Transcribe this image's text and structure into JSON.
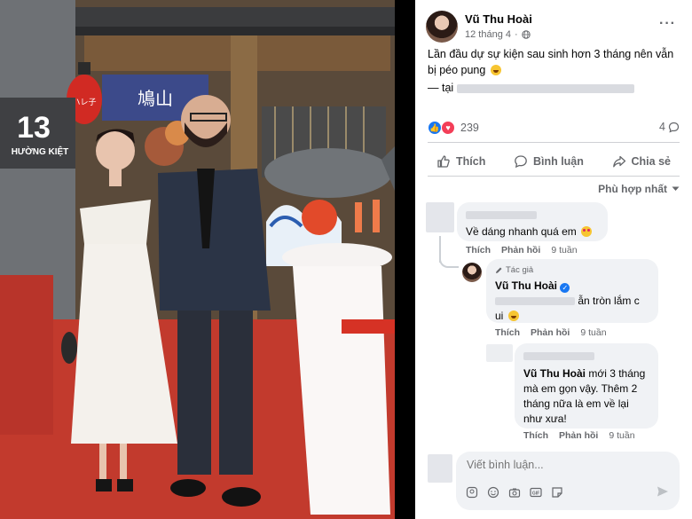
{
  "post": {
    "author": "Vũ Thu Hoài",
    "date": "12 tháng 4",
    "text": "Lần đầu dự sự kiện sau sinh hơn 3 tháng nên vẫn bị péo pung",
    "location_prefix": "— tại",
    "reaction_count": "239",
    "comment_count": "4"
  },
  "actions": {
    "like": "Thích",
    "comment": "Bình luận",
    "share": "Chia sẻ"
  },
  "sort_label": "Phù hợp nhất",
  "comments": [
    {
      "text": "Về dáng nhanh quá em",
      "like": "Thích",
      "reply": "Phản hồi",
      "time": "9 tuần"
    },
    {
      "badge": "Tác giả",
      "name": "Vũ Thu Hoài",
      "text_tail": "ẫn tròn lắm c",
      "text_line2": "ui",
      "like": "Thích",
      "reply": "Phản hồi",
      "time": "9 tuần"
    },
    {
      "name": "Vũ Thu Hoài",
      "text": "mới 3 tháng mà em gọn vậy. Thêm 2 tháng nữa là em về lại như xưa!",
      "like": "Thích",
      "reply": "Phản hồi",
      "time": "9 tuần"
    }
  ],
  "composer": {
    "placeholder": "Viết bình luận..."
  },
  "photo": {
    "sign_number": "13",
    "sign_text": "HƯỜNG KIỆT",
    "lantern_text": "ハレ子",
    "banner_text": "鳩山"
  },
  "colors": {
    "accent": "#1877f2",
    "love": "#f33e58",
    "carpet": "#c23a2d"
  }
}
